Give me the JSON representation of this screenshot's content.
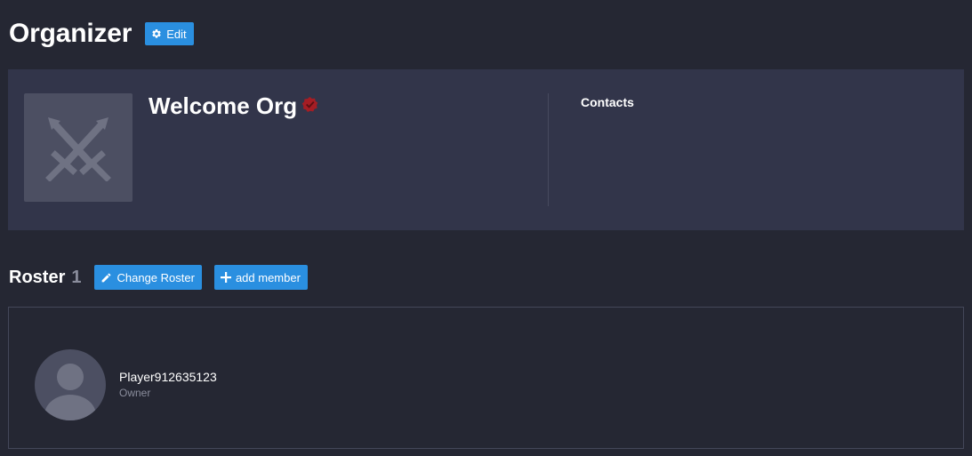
{
  "header": {
    "title": "Organizer",
    "edit_label": "Edit"
  },
  "org": {
    "name": "Welcome Org",
    "contacts_label": "Contacts",
    "logo_icon": "crossed-swords-icon",
    "badge_icon": "verified-badge-icon"
  },
  "roster": {
    "title": "Roster",
    "count": "1",
    "change_label": "Change Roster",
    "add_label": "add member",
    "members": [
      {
        "name": "Player912635123",
        "role": "Owner",
        "avatar_icon": "user-avatar-icon"
      }
    ]
  },
  "colors": {
    "background": "#252733",
    "card": "#32354a",
    "accent": "#2a8fe0",
    "muted": "#8a8d9c",
    "badge": "#a51d24"
  }
}
